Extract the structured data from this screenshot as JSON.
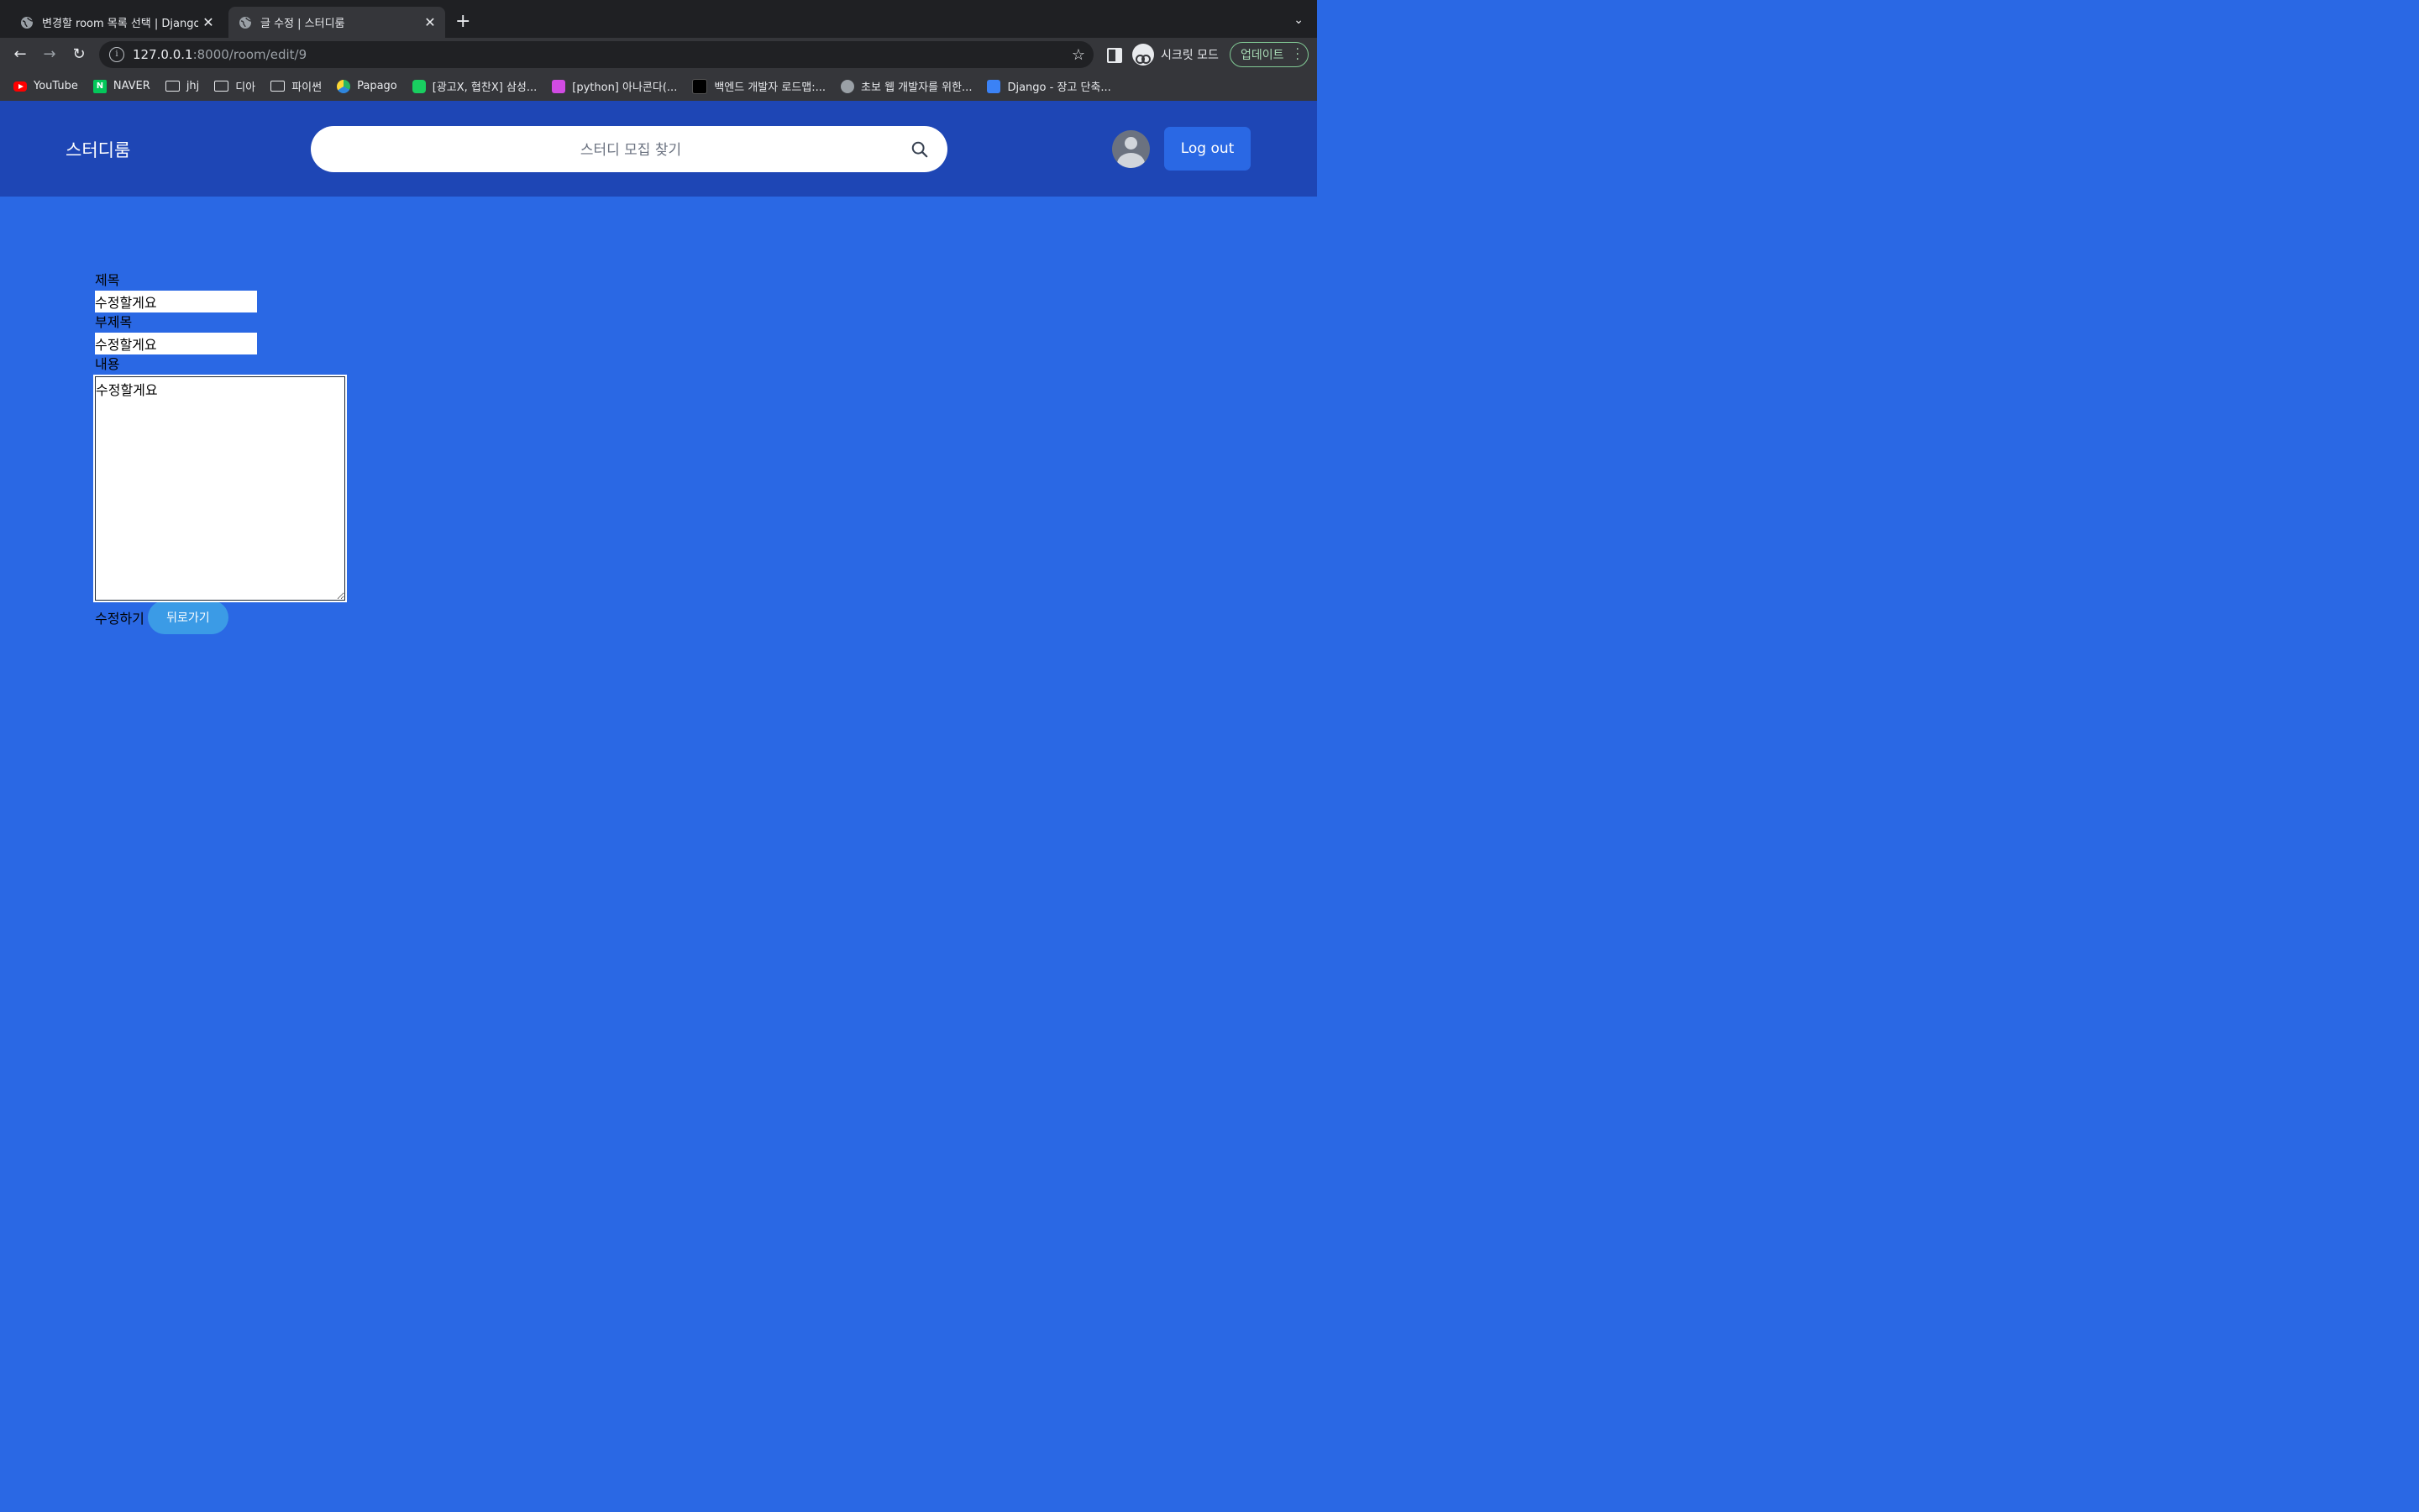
{
  "browser": {
    "tabs": [
      {
        "title": "변경할 room 목록 선택 | Django 사"
      },
      {
        "title": "글 수정 | 스터디룸"
      }
    ],
    "url_host": "127.0.0.1",
    "url_path": ":8000/room/edit/9",
    "incognito_label": "시크릿 모드",
    "update_label": "업데이트",
    "bookmarks": [
      {
        "label": "YouTube",
        "icon": "youtube-icon"
      },
      {
        "label": "NAVER",
        "icon": "naver-icon"
      },
      {
        "label": "jhj",
        "icon": "folder-icon"
      },
      {
        "label": "디아",
        "icon": "folder-icon"
      },
      {
        "label": "파이썬",
        "icon": "folder-icon"
      },
      {
        "label": "Papago",
        "icon": "papago-icon"
      },
      {
        "label": "[광고X, 협찬X] 삼성...",
        "icon": "blog-icon"
      },
      {
        "label": "[python] 아나콘다(...",
        "icon": "g4n-icon"
      },
      {
        "label": "백엔드 개발자 로드맵:...",
        "icon": "r-icon"
      },
      {
        "label": "초보 웹 개발자를 위한...",
        "icon": "globe-icon"
      },
      {
        "label": "Django - 장고 단축...",
        "icon": "django-icon"
      }
    ]
  },
  "site": {
    "logo": "스터디룸",
    "search_placeholder": "스터디 모집 찾기",
    "logout_label": "Log out"
  },
  "form": {
    "title_label": "제목",
    "title_value": "수정할게요",
    "subtitle_label": "부제목",
    "subtitle_value": "수정할게요",
    "content_label": "내용",
    "content_value": "수정할게요",
    "submit_label": "수정하기",
    "back_label": "뒤로가기"
  },
  "colors": {
    "page_bg": "#2a68e4",
    "header_bg": "#1e46b5",
    "back_button": "#3b9be6"
  }
}
